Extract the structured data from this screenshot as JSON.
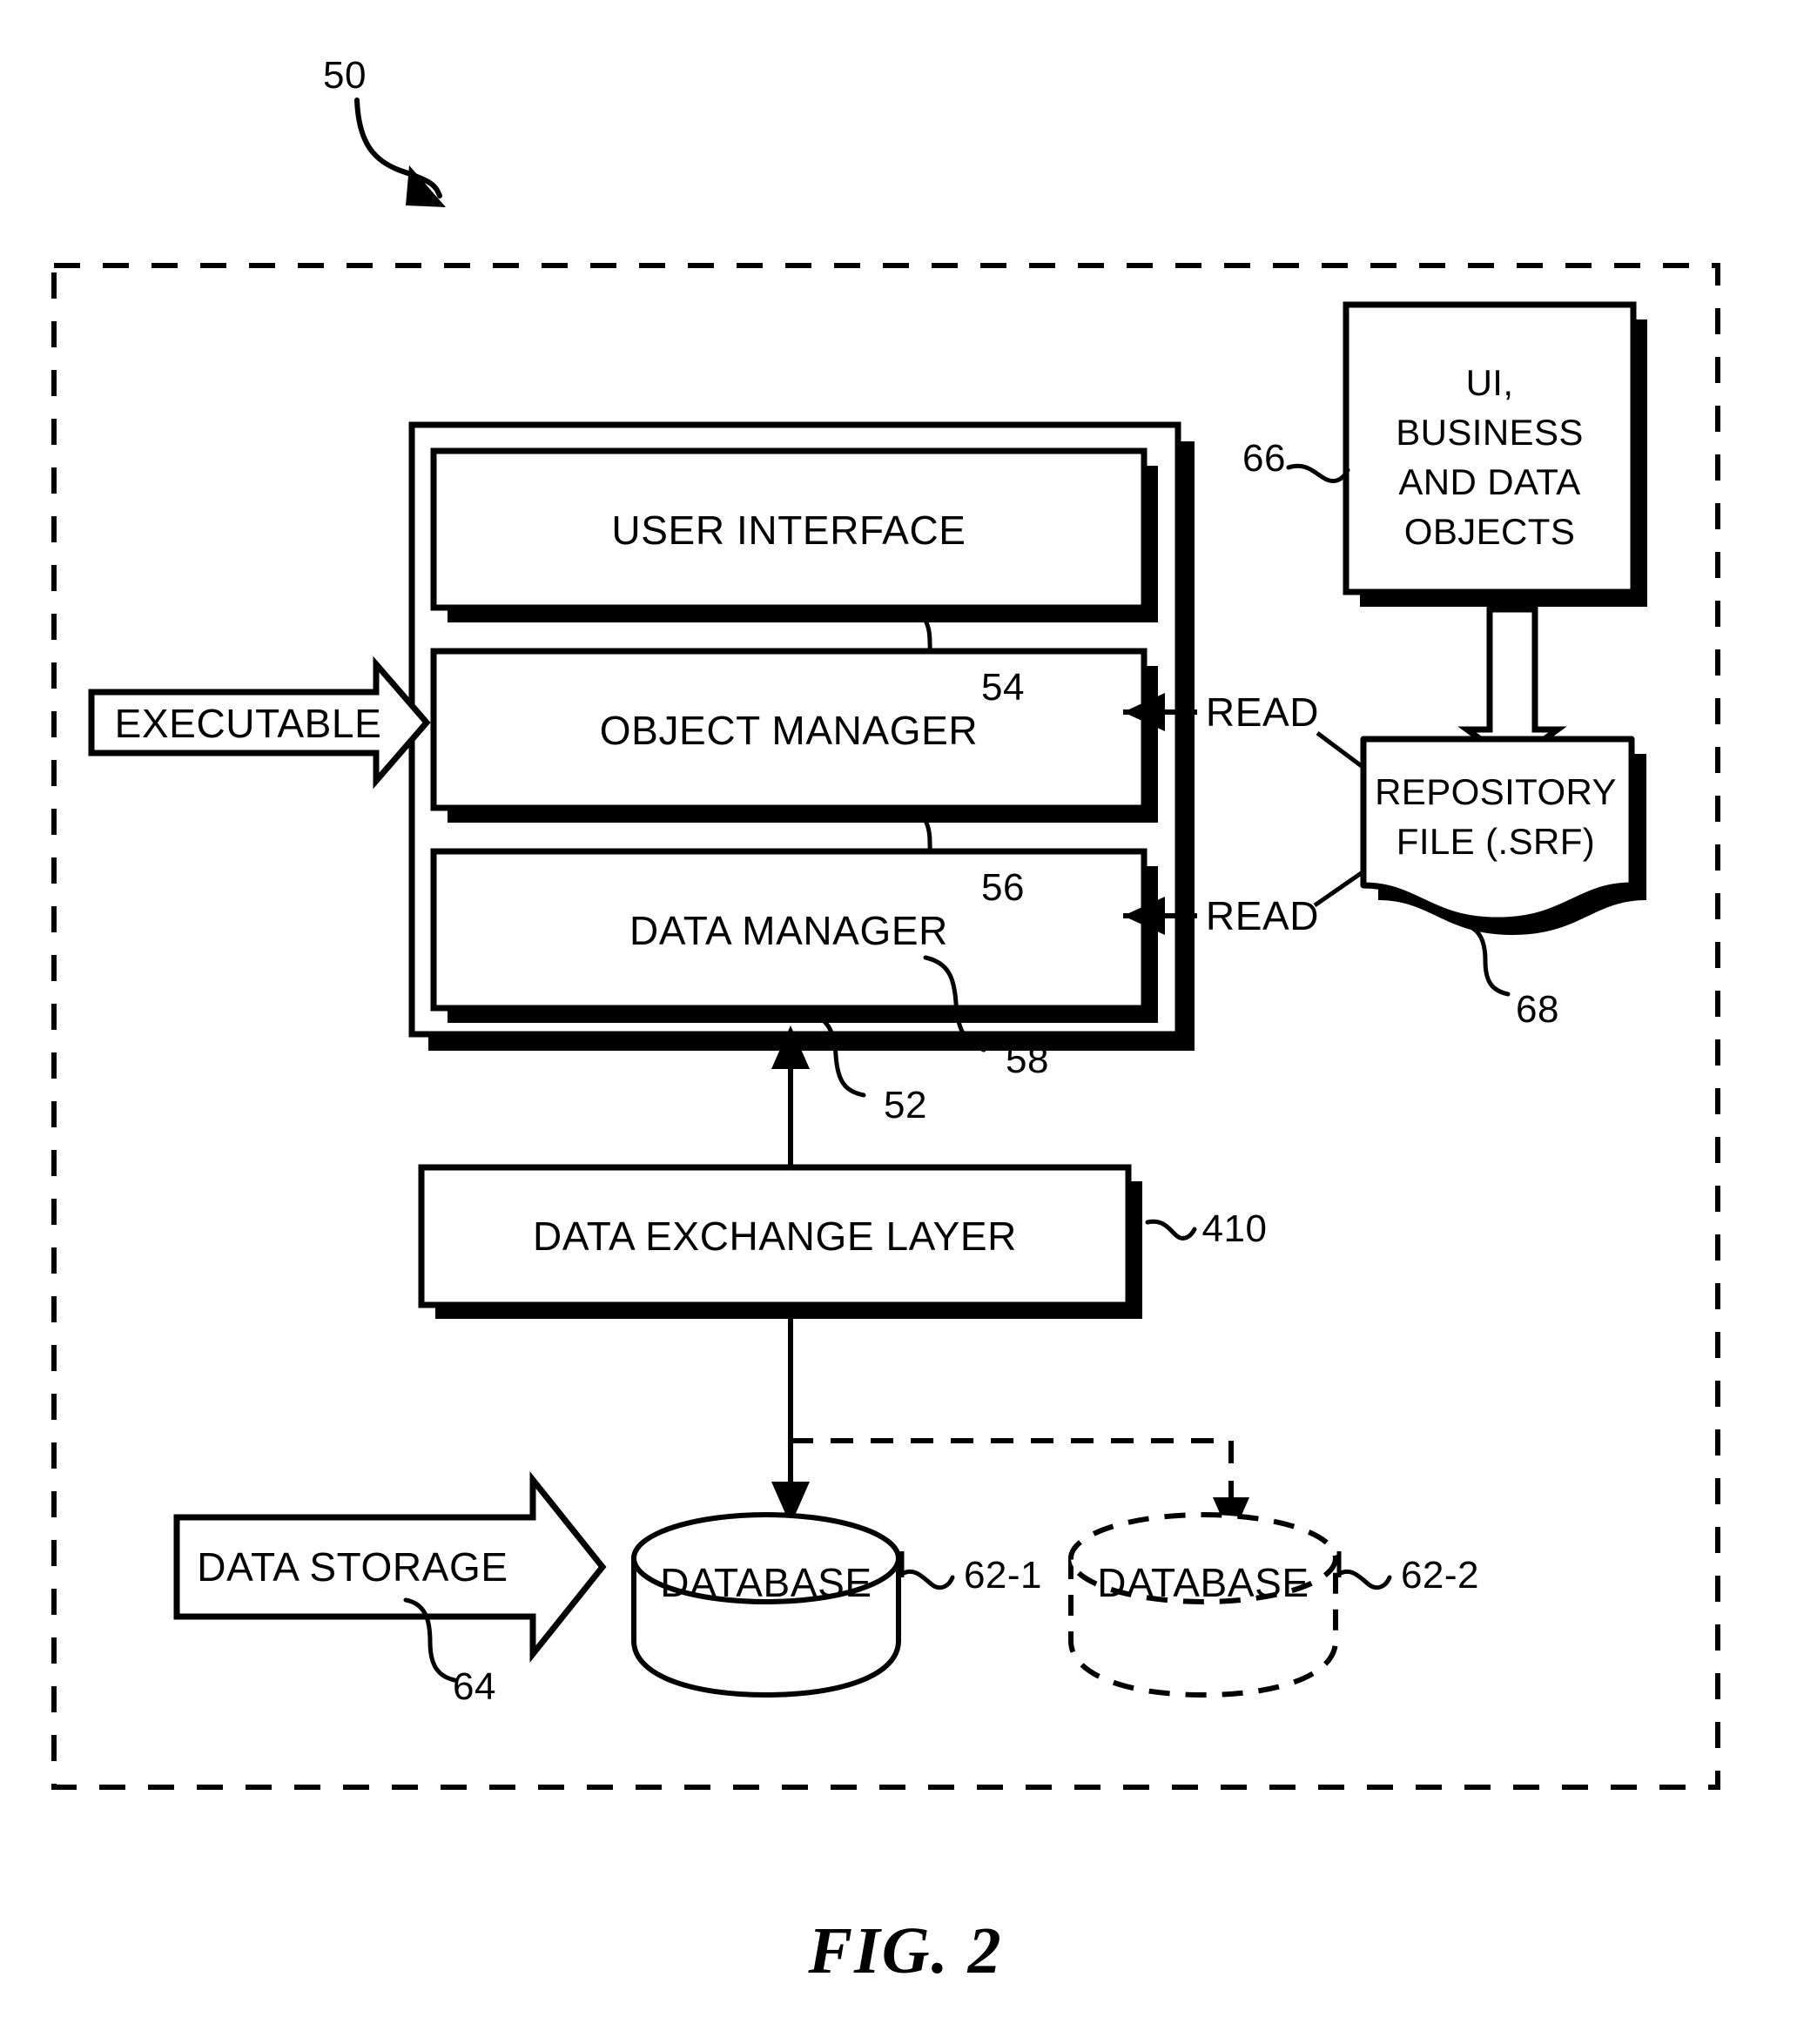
{
  "figure": {
    "caption": "FIG. 2",
    "system_ref": "50"
  },
  "boundary": {
    "name": "system-boundary",
    "style": "dashed"
  },
  "application": {
    "ref": "52",
    "layers": [
      {
        "label": "USER INTERFACE",
        "ref": "54"
      },
      {
        "label": "OBJECT MANAGER",
        "ref": "56"
      },
      {
        "label": "DATA MANAGER",
        "ref": "58"
      }
    ]
  },
  "inputs": {
    "executable_arrow_label": "EXECUTABLE",
    "data_storage_arrow_label": "DATA STORAGE",
    "data_storage_ref": "64"
  },
  "objects_box": {
    "lines": [
      "UI,",
      "BUSINESS",
      "AND DATA",
      "OBJECTS"
    ],
    "ref": "66"
  },
  "repository": {
    "lines": [
      "REPOSITORY",
      "FILE (.SRF)"
    ],
    "ref": "68"
  },
  "read_edges": [
    {
      "label": "READ",
      "target": "OBJECT MANAGER"
    },
    {
      "label": "READ",
      "target": "DATA MANAGER"
    }
  ],
  "exchange_layer": {
    "label": "DATA EXCHANGE LAYER",
    "ref": "410"
  },
  "databases": [
    {
      "label": "DATABASE",
      "ref": "62-1",
      "style": "solid"
    },
    {
      "label": "DATABASE",
      "ref": "62-2",
      "style": "dashed"
    }
  ],
  "colors": {
    "ink": "#000000",
    "paper": "#ffffff"
  }
}
